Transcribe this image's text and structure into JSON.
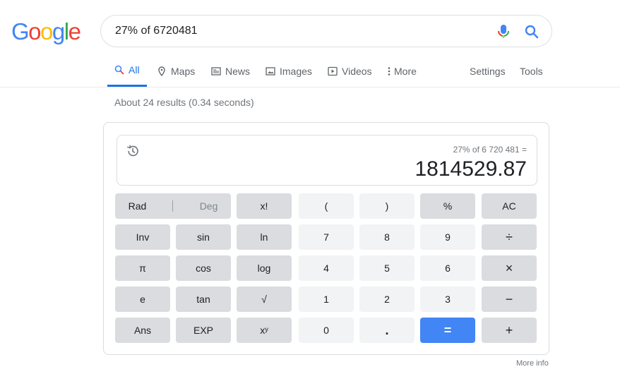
{
  "logo": {
    "letters": [
      "G",
      "o",
      "o",
      "g",
      "l",
      "e"
    ],
    "colors": [
      "#4285f4",
      "#ea4335",
      "#fbbc05",
      "#4285f4",
      "#34a853",
      "#ea4335"
    ]
  },
  "search": {
    "query": "27% of 6720481"
  },
  "tabs": [
    {
      "label": "All",
      "icon": "search-icon"
    },
    {
      "label": "Maps",
      "icon": "map-pin-icon"
    },
    {
      "label": "News",
      "icon": "news-icon"
    },
    {
      "label": "Images",
      "icon": "image-icon"
    },
    {
      "label": "Videos",
      "icon": "video-icon"
    },
    {
      "label": "More",
      "icon": "more-vertical-icon"
    }
  ],
  "tools": {
    "settings": "Settings",
    "tools": "Tools"
  },
  "stats": "About 24 results (0.34 seconds)",
  "calculator": {
    "expression": "27% of 6 720 481 =",
    "result": "1814529.87",
    "rad": "Rad",
    "deg": "Deg",
    "keys": {
      "fact": "x!",
      "lparen": "(",
      "rparen": ")",
      "percent": "%",
      "ac": "AC",
      "inv": "Inv",
      "sin": "sin",
      "ln": "ln",
      "k7": "7",
      "k8": "8",
      "k9": "9",
      "divide": "÷",
      "pi": "π",
      "cos": "cos",
      "log": "log",
      "k4": "4",
      "k5": "5",
      "k6": "6",
      "multiply": "×",
      "e": "e",
      "tan": "tan",
      "sqrt": "√",
      "k1": "1",
      "k2": "2",
      "k3": "3",
      "minus": "−",
      "ans": "Ans",
      "exp": "EXP",
      "pow": "xʸ",
      "k0": "0",
      "dot": ".",
      "equals": "=",
      "plus": "+"
    }
  },
  "more_info": "More info",
  "colors": {
    "accent": "#1a73e8",
    "equals_key": "#4285f4"
  }
}
